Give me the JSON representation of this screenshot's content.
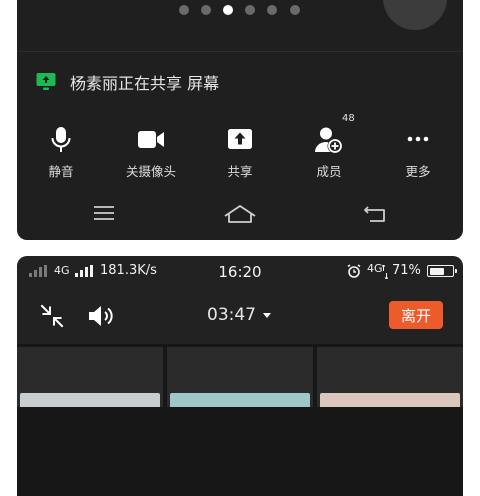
{
  "meeting_panel": {
    "pager": {
      "count": 6,
      "active_index": 2
    },
    "share_banner": {
      "text": "杨素丽正在共享 屏幕",
      "icon": "screen-share-icon",
      "icon_color": "#1db954"
    },
    "toolbar": [
      {
        "id": "mute",
        "label": "静音",
        "icon": "microphone-icon"
      },
      {
        "id": "camera",
        "label": "关摄像头",
        "icon": "video-camera-icon"
      },
      {
        "id": "share",
        "label": "共享",
        "icon": "share-upload-icon"
      },
      {
        "id": "members",
        "label": "成员",
        "icon": "add-member-icon",
        "badge": "48"
      },
      {
        "id": "more",
        "label": "更多",
        "icon": "more-dots-icon"
      }
    ],
    "nav_bar": [
      "menu-icon",
      "home-icon",
      "back-icon"
    ]
  },
  "phone_screen": {
    "status_bar": {
      "signal": "4G",
      "network_speed": "181.3K/s",
      "time": "16:20",
      "network_right": "4G",
      "battery_percent": "71%",
      "battery_level": 0.71
    },
    "call_bar": {
      "timer": "03:47",
      "leave_label": "离开",
      "leave_color": "#ee5b2b"
    },
    "thumbnail_colors": [
      "#c9ccd0",
      "#9fc7c9",
      "#d9c7bb"
    ]
  }
}
